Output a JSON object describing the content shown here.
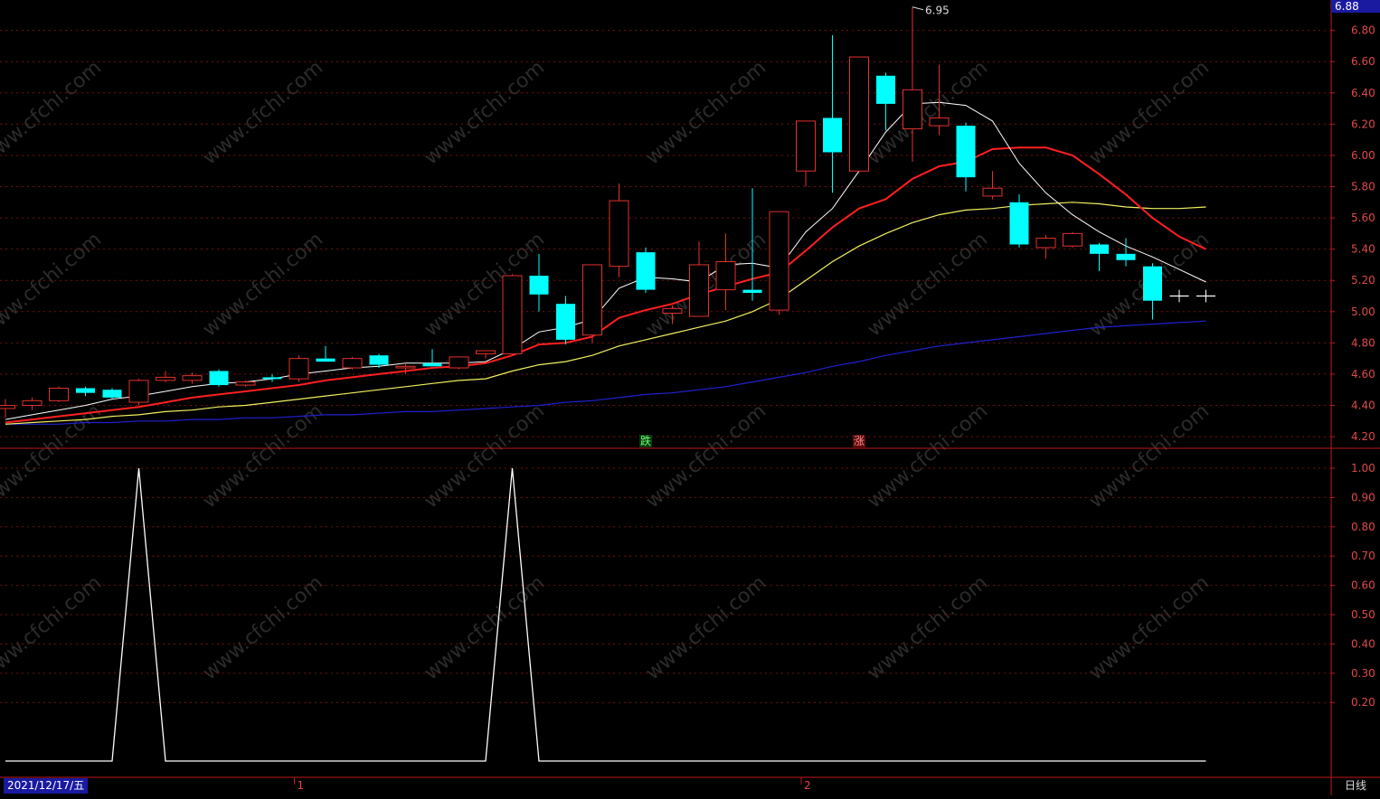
{
  "header": {
    "last_price_tag": "6.88"
  },
  "footer": {
    "date_label": "2021/12/17/五",
    "period_label": "日线",
    "month_marks": [
      "1",
      "2"
    ]
  },
  "watermark": {
    "text": "www.cfchi.com"
  },
  "colors": {
    "up": "#e0322e",
    "down": "#00ffff",
    "ma5": "#ffffff",
    "ma10": "#ff2020",
    "ma20": "#f0f060",
    "ma60": "#2020d0",
    "grid": "#7a1010",
    "axis": "#c01818",
    "indicator": "#ffffff"
  },
  "chart_data": [
    {
      "type": "candlestick",
      "y_ticks": [
        "6.80",
        "6.60",
        "6.40",
        "6.20",
        "6.00",
        "5.80",
        "5.60",
        "5.40",
        "5.20",
        "5.00",
        "4.80",
        "4.60",
        "4.40",
        "4.20"
      ],
      "ylim": [
        4.16,
        6.96
      ],
      "max_annotation": "6.95",
      "signals": [
        {
          "label": "跌",
          "index": 24,
          "kind": "down"
        },
        {
          "label": "涨",
          "index": 32,
          "kind": "up"
        }
      ],
      "candles": [
        {
          "o": 4.38,
          "h": 4.44,
          "l": 4.32,
          "c": 4.4
        },
        {
          "o": 4.4,
          "h": 4.45,
          "l": 4.37,
          "c": 4.43
        },
        {
          "o": 4.43,
          "h": 4.52,
          "l": 4.42,
          "c": 4.51
        },
        {
          "o": 4.51,
          "h": 4.52,
          "l": 4.46,
          "c": 4.48
        },
        {
          "o": 4.5,
          "h": 4.51,
          "l": 4.44,
          "c": 4.45
        },
        {
          "o": 4.42,
          "h": 4.57,
          "l": 4.4,
          "c": 4.56
        },
        {
          "o": 4.56,
          "h": 4.62,
          "l": 4.55,
          "c": 4.58
        },
        {
          "o": 4.56,
          "h": 4.61,
          "l": 4.54,
          "c": 4.59
        },
        {
          "o": 4.62,
          "h": 4.63,
          "l": 4.52,
          "c": 4.53
        },
        {
          "o": 4.53,
          "h": 4.56,
          "l": 4.52,
          "c": 4.55
        },
        {
          "o": 4.58,
          "h": 4.6,
          "l": 4.55,
          "c": 4.57
        },
        {
          "o": 4.57,
          "h": 4.72,
          "l": 4.55,
          "c": 4.7
        },
        {
          "o": 4.7,
          "h": 4.78,
          "l": 4.68,
          "c": 4.68
        },
        {
          "o": 4.64,
          "h": 4.71,
          "l": 4.63,
          "c": 4.7
        },
        {
          "o": 4.72,
          "h": 4.73,
          "l": 4.64,
          "c": 4.66
        },
        {
          "o": 4.64,
          "h": 4.67,
          "l": 4.6,
          "c": 4.65
        },
        {
          "o": 4.67,
          "h": 4.76,
          "l": 4.65,
          "c": 4.65
        },
        {
          "o": 4.64,
          "h": 4.71,
          "l": 4.63,
          "c": 4.71
        },
        {
          "o": 4.73,
          "h": 4.75,
          "l": 4.7,
          "c": 4.75
        },
        {
          "o": 4.73,
          "h": 5.24,
          "l": 4.72,
          "c": 5.23
        },
        {
          "o": 5.23,
          "h": 5.37,
          "l": 5.0,
          "c": 5.11
        },
        {
          "o": 5.05,
          "h": 5.1,
          "l": 4.79,
          "c": 4.82
        },
        {
          "o": 4.85,
          "h": 5.3,
          "l": 4.8,
          "c": 5.3
        },
        {
          "o": 5.29,
          "h": 5.82,
          "l": 5.22,
          "c": 5.71
        },
        {
          "o": 5.38,
          "h": 5.41,
          "l": 5.12,
          "c": 5.14
        },
        {
          "o": 4.99,
          "h": 5.04,
          "l": 4.92,
          "c": 5.02
        },
        {
          "o": 4.97,
          "h": 5.45,
          "l": 4.97,
          "c": 5.3
        },
        {
          "o": 5.14,
          "h": 5.5,
          "l": 5.01,
          "c": 5.32
        },
        {
          "o": 5.14,
          "h": 5.79,
          "l": 5.07,
          "c": 5.12
        },
        {
          "o": 5.01,
          "h": 5.64,
          "l": 4.98,
          "c": 5.64
        },
        {
          "o": 5.9,
          "h": 6.22,
          "l": 5.8,
          "c": 6.22
        },
        {
          "o": 6.24,
          "h": 6.77,
          "l": 5.76,
          "c": 6.02
        },
        {
          "o": 5.9,
          "h": 6.63,
          "l": 5.89,
          "c": 6.63
        },
        {
          "o": 6.51,
          "h": 6.53,
          "l": 6.16,
          "c": 6.33
        },
        {
          "o": 6.17,
          "h": 6.95,
          "l": 5.96,
          "c": 6.42
        },
        {
          "o": 6.19,
          "h": 6.58,
          "l": 6.13,
          "c": 6.24
        },
        {
          "o": 6.19,
          "h": 6.21,
          "l": 5.77,
          "c": 5.86
        },
        {
          "o": 5.74,
          "h": 5.9,
          "l": 5.72,
          "c": 5.79
        },
        {
          "o": 5.7,
          "h": 5.75,
          "l": 5.41,
          "c": 5.43
        },
        {
          "o": 5.41,
          "h": 5.49,
          "l": 5.34,
          "c": 5.47
        },
        {
          "o": 5.42,
          "h": 5.51,
          "l": 5.41,
          "c": 5.5
        },
        {
          "o": 5.43,
          "h": 5.44,
          "l": 5.26,
          "c": 5.37
        },
        {
          "o": 5.37,
          "h": 5.47,
          "l": 5.29,
          "c": 5.33
        },
        {
          "o": 5.29,
          "h": 5.31,
          "l": 4.95,
          "c": 5.07
        },
        {
          "o": 5.1,
          "h": 5.14,
          "l": 5.06,
          "c": 5.1
        },
        {
          "o": 5.1,
          "h": 5.14,
          "l": 5.06,
          "c": 5.1
        }
      ],
      "ma5": [
        4.31,
        4.34,
        4.37,
        4.4,
        4.44,
        4.46,
        4.49,
        4.52,
        4.54,
        4.55,
        4.57,
        4.6,
        4.62,
        4.64,
        4.65,
        4.67,
        4.67,
        4.67,
        4.68,
        4.76,
        4.87,
        4.9,
        4.95,
        5.15,
        5.22,
        5.21,
        5.19,
        5.3,
        5.31,
        5.28,
        5.51,
        5.66,
        5.9,
        6.15,
        6.33,
        6.34,
        6.32,
        6.22,
        5.95,
        5.76,
        5.62,
        5.51,
        5.42,
        5.35,
        5.27,
        5.19
      ],
      "ma10": [
        4.29,
        4.31,
        4.33,
        4.35,
        4.37,
        4.39,
        4.42,
        4.45,
        4.47,
        4.49,
        4.51,
        4.53,
        4.56,
        4.58,
        4.6,
        4.62,
        4.64,
        4.65,
        4.67,
        4.72,
        4.79,
        4.8,
        4.84,
        4.96,
        5.01,
        5.05,
        5.11,
        5.16,
        5.21,
        5.25,
        5.39,
        5.54,
        5.66,
        5.72,
        5.85,
        5.93,
        5.96,
        6.04,
        6.05,
        6.05,
        6.0,
        5.88,
        5.75,
        5.6,
        5.48,
        5.4
      ],
      "ma20": [
        4.28,
        4.29,
        4.3,
        4.31,
        4.33,
        4.34,
        4.36,
        4.37,
        4.39,
        4.4,
        4.42,
        4.44,
        4.46,
        4.48,
        4.5,
        4.52,
        4.54,
        4.56,
        4.57,
        4.62,
        4.66,
        4.68,
        4.72,
        4.78,
        4.82,
        4.86,
        4.9,
        4.94,
        5.0,
        5.08,
        5.2,
        5.32,
        5.42,
        5.5,
        5.57,
        5.62,
        5.65,
        5.66,
        5.68,
        5.69,
        5.7,
        5.69,
        5.67,
        5.66,
        5.66,
        5.67
      ],
      "ma60": [
        4.28,
        4.28,
        4.28,
        4.29,
        4.29,
        4.3,
        4.3,
        4.31,
        4.31,
        4.32,
        4.32,
        4.33,
        4.34,
        4.34,
        4.35,
        4.36,
        4.36,
        4.37,
        4.38,
        4.39,
        4.4,
        4.42,
        4.43,
        4.45,
        4.47,
        4.48,
        4.5,
        4.52,
        4.55,
        4.58,
        4.61,
        4.65,
        4.68,
        4.72,
        4.75,
        4.78,
        4.8,
        4.82,
        4.84,
        4.86,
        4.88,
        4.9,
        4.91,
        4.92,
        4.93,
        4.94
      ]
    },
    {
      "type": "line",
      "y_ticks": [
        "1.00",
        "0.90",
        "0.80",
        "0.70",
        "0.60",
        "0.50",
        "0.40",
        "0.30",
        "0.20"
      ],
      "ylim": [
        -0.04,
        1.0
      ],
      "values": [
        0,
        0,
        0,
        0,
        0,
        1,
        0,
        0,
        0,
        0,
        0,
        0,
        0,
        0,
        0,
        0,
        0,
        0,
        0,
        1,
        0,
        0,
        0,
        0,
        0,
        0,
        0,
        0,
        0,
        0,
        0,
        0,
        0,
        0,
        0,
        0,
        0,
        0,
        0,
        0,
        0,
        0,
        0,
        0,
        0,
        0
      ]
    }
  ]
}
